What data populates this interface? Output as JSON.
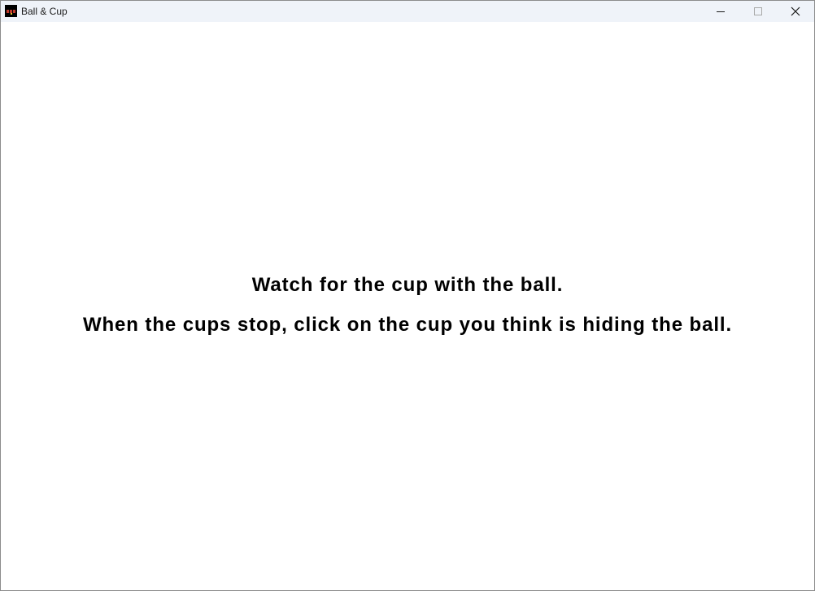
{
  "window": {
    "title": "Ball & Cup",
    "icon": "ball-and-cup-app-icon"
  },
  "controls": {
    "minimize_icon": "minimize-icon",
    "maximize_icon": "maximize-icon",
    "close_icon": "close-icon"
  },
  "game": {
    "instructions": [
      "Watch for the cup with the ball.",
      "When the cups stop, click on the cup you think is hiding the ball."
    ]
  },
  "colors": {
    "titlebar_bg": "#eff3f9",
    "canvas_bg": "#ffffff",
    "text": "#000000"
  }
}
